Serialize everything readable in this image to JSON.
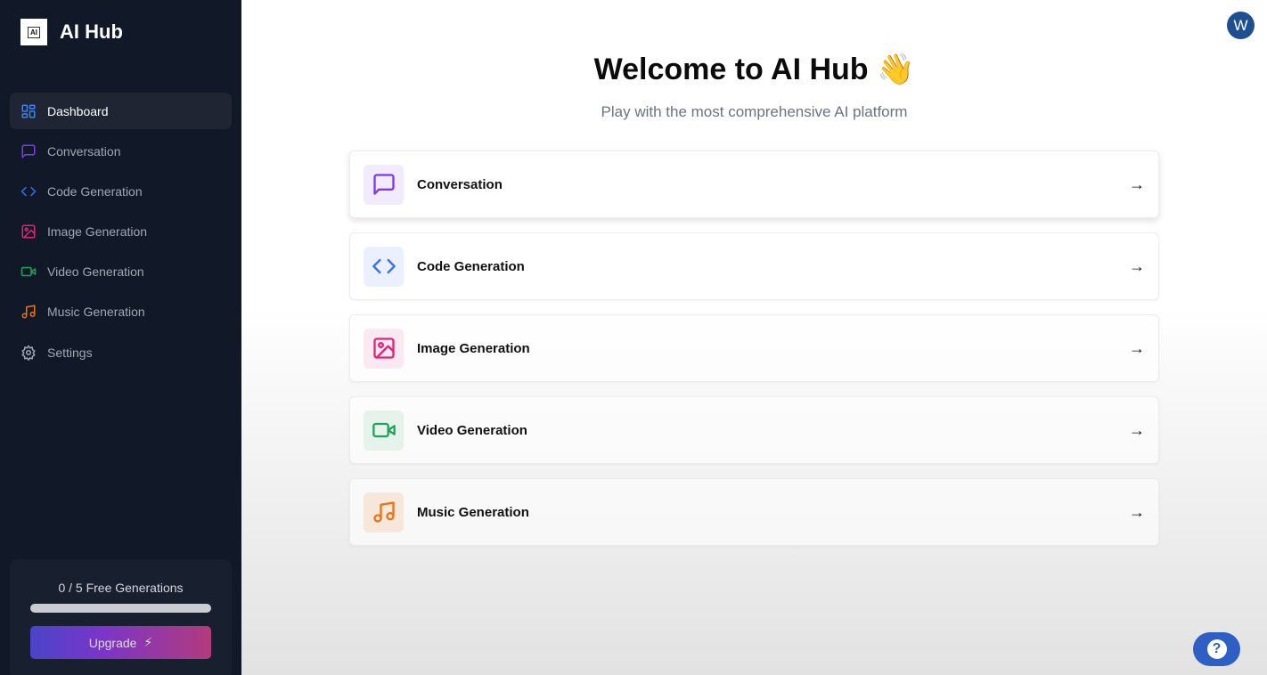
{
  "app": {
    "title": "AI Hub",
    "logo_text": "AI"
  },
  "sidebar": {
    "items": [
      {
        "label": "Dashboard",
        "icon": "dashboard-icon",
        "color": "#3b82f6"
      },
      {
        "label": "Conversation",
        "icon": "message-icon",
        "color": "#7c3aed"
      },
      {
        "label": "Code Generation",
        "icon": "code-icon",
        "color": "#3b6ff0"
      },
      {
        "label": "Image Generation",
        "icon": "image-icon",
        "color": "#db2777"
      },
      {
        "label": "Video Generation",
        "icon": "video-icon",
        "color": "#22a35a"
      },
      {
        "label": "Music Generation",
        "icon": "music-icon",
        "color": "#ea7317"
      },
      {
        "label": "Settings",
        "icon": "gear-icon",
        "color": "#a1a7b3"
      }
    ]
  },
  "usage": {
    "text": "0 / 5 Free Generations",
    "used": 0,
    "limit": 5,
    "upgrade_label": "Upgrade"
  },
  "main": {
    "title": "Welcome to AI Hub 👋",
    "subtitle": "Play with the most comprehensive AI platform",
    "cards": [
      {
        "label": "Conversation",
        "color": "#7c3aed",
        "bg": "#f1ebfd"
      },
      {
        "label": "Code Generation",
        "color": "#3b6ff0",
        "bg": "#eaf0fd"
      },
      {
        "label": "Image Generation",
        "color": "#db2777",
        "bg": "#fbe9f1"
      },
      {
        "label": "Video Generation",
        "color": "#22a35a",
        "bg": "#e6f3ea"
      },
      {
        "label": "Music Generation",
        "color": "#ea7317",
        "bg": "#f6e7da"
      }
    ]
  },
  "user": {
    "initial": "W"
  },
  "help": {
    "symbol": "?"
  }
}
